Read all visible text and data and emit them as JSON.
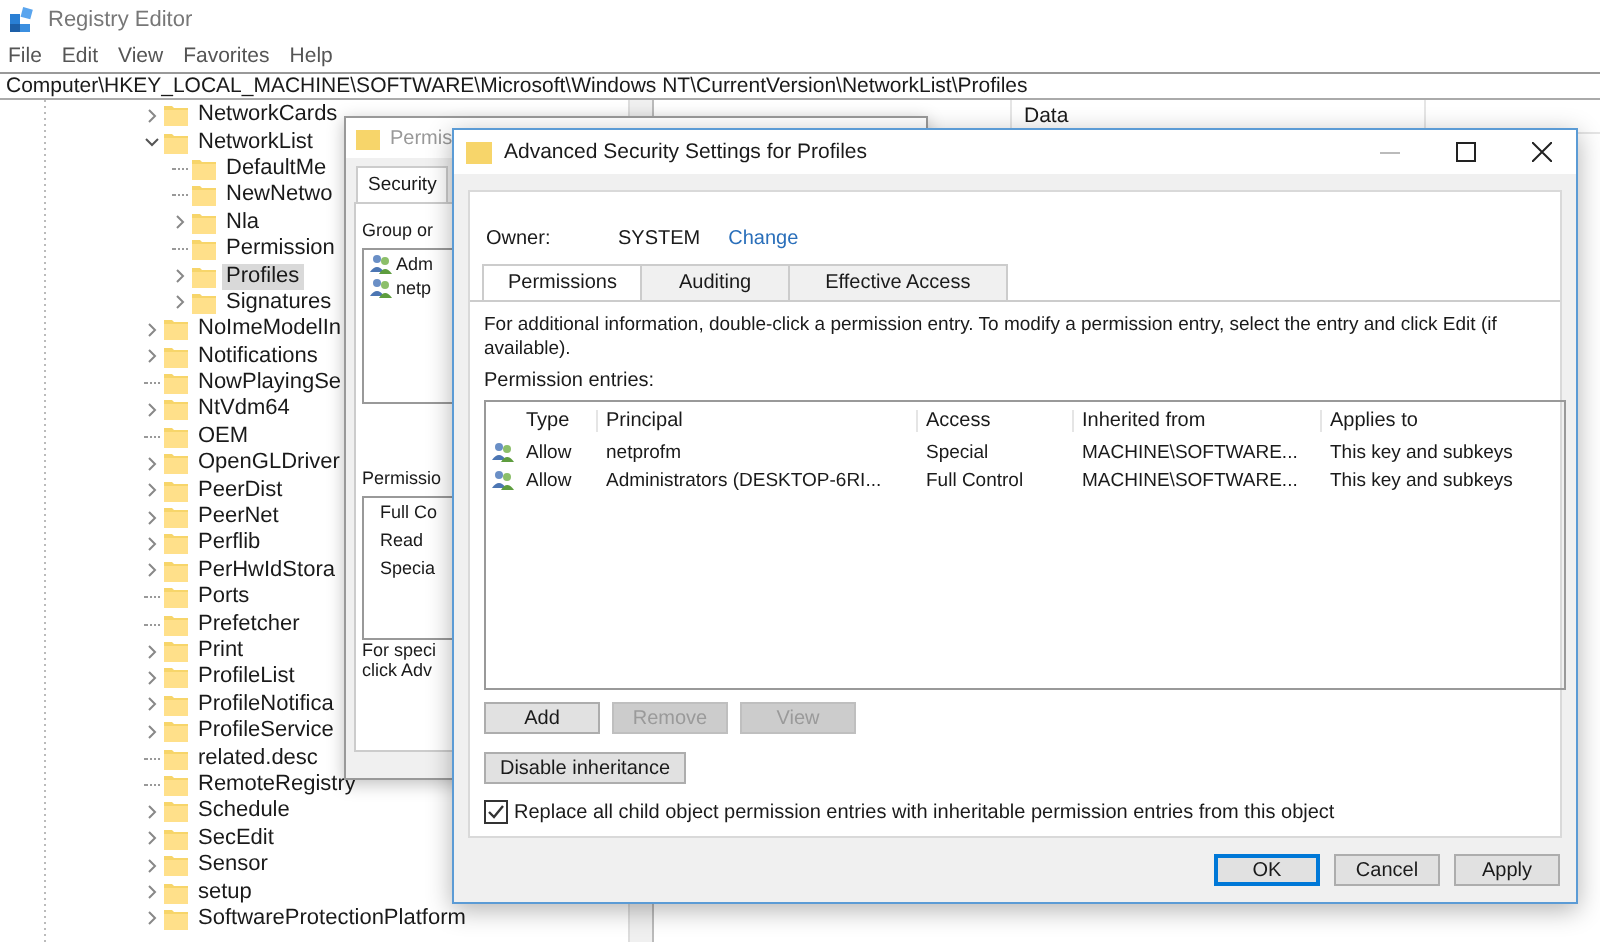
{
  "window": {
    "title": "Registry Editor"
  },
  "menu": [
    "File",
    "Edit",
    "View",
    "Favorites",
    "Help"
  ],
  "address": "Computer\\HKEY_LOCAL_MACHINE\\SOFTWARE\\Microsoft\\Windows NT\\CurrentVersion\\NetworkList\\Profiles",
  "tree": [
    {
      "label": "NetworkCards",
      "expandable": true,
      "expanded": false,
      "selected": false
    },
    {
      "label": "NetworkList",
      "expandable": true,
      "expanded": true,
      "selected": false,
      "children": [
        {
          "label": "DefaultMe",
          "expandable": false,
          "selected": false
        },
        {
          "label": "NewNetwo",
          "expandable": false,
          "selected": false
        },
        {
          "label": "Nla",
          "expandable": true,
          "expanded": false,
          "selected": false
        },
        {
          "label": "Permission",
          "expandable": false,
          "selected": false
        },
        {
          "label": "Profiles",
          "expandable": true,
          "expanded": false,
          "selected": true
        },
        {
          "label": "Signatures",
          "expandable": true,
          "expanded": false,
          "selected": false
        }
      ]
    },
    {
      "label": "NoImeModelIn",
      "expandable": true,
      "expanded": false,
      "selected": false
    },
    {
      "label": "Notifications",
      "expandable": true,
      "expanded": false,
      "selected": false
    },
    {
      "label": "NowPlayingSe",
      "expandable": false,
      "selected": false
    },
    {
      "label": "NtVdm64",
      "expandable": true,
      "expanded": false,
      "selected": false
    },
    {
      "label": "OEM",
      "expandable": false,
      "selected": false
    },
    {
      "label": "OpenGLDriver",
      "expandable": true,
      "expanded": false,
      "selected": false
    },
    {
      "label": "PeerDist",
      "expandable": true,
      "expanded": false,
      "selected": false
    },
    {
      "label": "PeerNet",
      "expandable": true,
      "expanded": false,
      "selected": false
    },
    {
      "label": "Perflib",
      "expandable": true,
      "expanded": false,
      "selected": false
    },
    {
      "label": "PerHwIdStora",
      "expandable": true,
      "expanded": false,
      "selected": false
    },
    {
      "label": "Ports",
      "expandable": false,
      "selected": false
    },
    {
      "label": "Prefetcher",
      "expandable": false,
      "selected": false
    },
    {
      "label": "Print",
      "expandable": true,
      "expanded": false,
      "selected": false
    },
    {
      "label": "ProfileList",
      "expandable": true,
      "expanded": false,
      "selected": false
    },
    {
      "label": "ProfileNotifica",
      "expandable": true,
      "expanded": false,
      "selected": false
    },
    {
      "label": "ProfileService",
      "expandable": true,
      "expanded": false,
      "selected": false
    },
    {
      "label": "related.desc",
      "expandable": false,
      "selected": false
    },
    {
      "label": "RemoteRegistry",
      "expandable": false,
      "selected": false
    },
    {
      "label": "Schedule",
      "expandable": true,
      "expanded": false,
      "selected": false
    },
    {
      "label": "SecEdit",
      "expandable": true,
      "expanded": false,
      "selected": false
    },
    {
      "label": "Sensor",
      "expandable": true,
      "expanded": false,
      "selected": false
    },
    {
      "label": "setup",
      "expandable": true,
      "expanded": false,
      "selected": false
    },
    {
      "label": "SoftwareProtectionPlatform",
      "expandable": true,
      "expanded": false,
      "selected": false
    }
  ],
  "values_pane": {
    "columns": [
      "Data"
    ]
  },
  "permissions_dialog": {
    "title": "Permis",
    "tabs": [
      {
        "label": "Security",
        "selected": true
      }
    ],
    "group_label": "Group or",
    "principals": [
      "Adm",
      "netp"
    ],
    "permissions_label": "Permissio",
    "permissions": [
      "Full Co",
      "Read",
      "Specia"
    ],
    "note": [
      "For speci",
      "click Adv"
    ]
  },
  "advanced_dialog": {
    "title": "Advanced Security Settings for Profiles",
    "owner_label": "Owner:",
    "owner": "SYSTEM",
    "change_link": "Change",
    "tabs": [
      {
        "label": "Permissions",
        "selected": true
      },
      {
        "label": "Auditing",
        "selected": false
      },
      {
        "label": "Effective Access",
        "selected": false
      }
    ],
    "info": "For additional information, double-click a permission entry. To modify a permission entry, select the entry and click Edit (if available).",
    "entries_label": "Permission entries:",
    "columns": [
      "Type",
      "Principal",
      "Access",
      "Inherited from",
      "Applies to"
    ],
    "rows": [
      {
        "type": "Allow",
        "principal": "netprofm",
        "access": "Special",
        "inherited_from": "MACHINE\\SOFTWARE...",
        "applies_to": "This key and subkeys"
      },
      {
        "type": "Allow",
        "principal": "Administrators (DESKTOP-6RI...",
        "access": "Full Control",
        "inherited_from": "MACHINE\\SOFTWARE...",
        "applies_to": "This key and subkeys"
      }
    ],
    "entry_buttons": [
      {
        "label": "Add",
        "disabled": false
      },
      {
        "label": "Remove",
        "disabled": true
      },
      {
        "label": "View",
        "disabled": true
      }
    ],
    "inheritance_button": "Disable inheritance",
    "replace_checkbox": {
      "label": "Replace all child object permission entries with inheritable permission entries from this object",
      "checked": true
    },
    "footer_buttons": [
      {
        "label": "OK",
        "default": true
      },
      {
        "label": "Cancel",
        "default": false
      },
      {
        "label": "Apply",
        "default": false
      }
    ]
  }
}
